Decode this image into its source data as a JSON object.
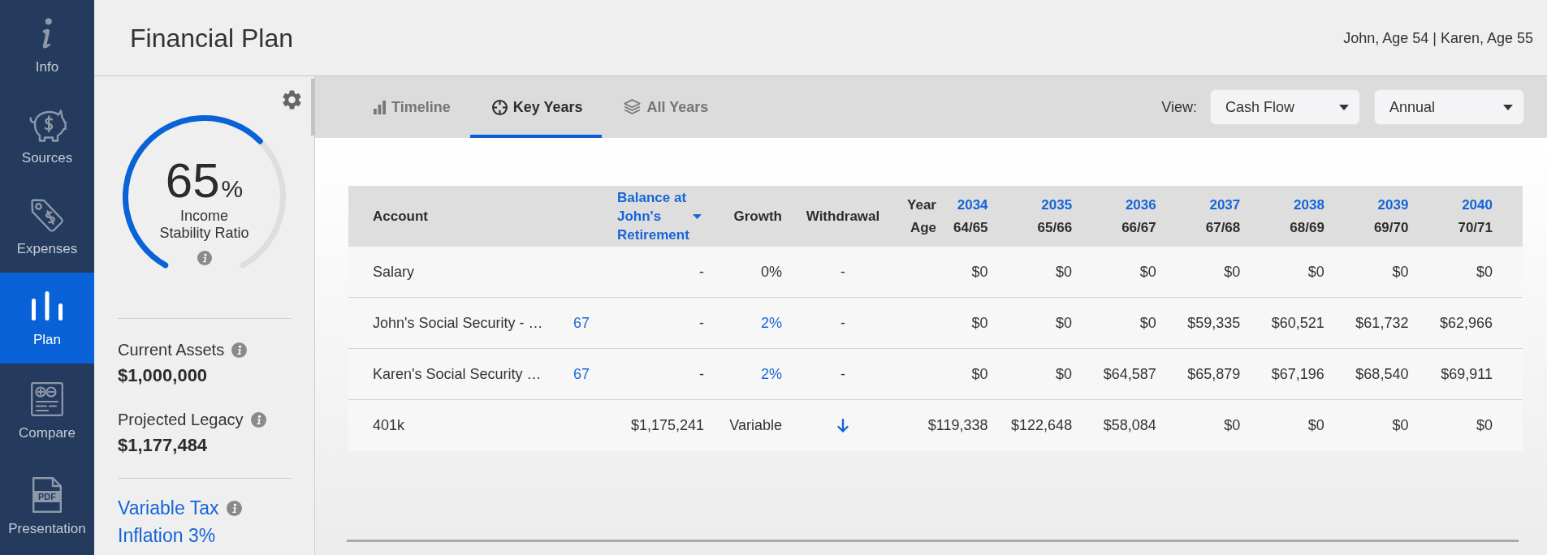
{
  "nav": {
    "items": [
      {
        "label": "Info",
        "selected": false
      },
      {
        "label": "Sources",
        "selected": false
      },
      {
        "label": "Expenses",
        "selected": false
      },
      {
        "label": "Plan",
        "selected": true
      },
      {
        "label": "Compare",
        "selected": false
      },
      {
        "label": "Presentation",
        "selected": false,
        "icon_text": "PDF"
      }
    ]
  },
  "header": {
    "title": "Financial Plan",
    "clients": "John, Age 54 | Karen, Age 55"
  },
  "summary": {
    "gauge": {
      "value": "65",
      "unit": "%",
      "label": "Income Stability Ratio"
    },
    "stats": [
      {
        "label": "Current Assets",
        "value": "$1,000,000"
      },
      {
        "label": "Projected Legacy",
        "value": "$1,177,484"
      }
    ],
    "settings": {
      "tax": "Variable Tax",
      "inflation": "Inflation 3%"
    }
  },
  "tabs": [
    {
      "label": "Timeline",
      "selected": false
    },
    {
      "label": "Key Years",
      "selected": true
    },
    {
      "label": "All Years",
      "selected": false
    }
  ],
  "view": {
    "label": "View:",
    "dropdowns": [
      {
        "value": "Cash Flow"
      },
      {
        "value": "Annual"
      }
    ]
  },
  "table": {
    "columns": [
      {
        "label": "Account",
        "sorted": false
      },
      {
        "label": "Balance at John's Retirement",
        "sorted": true
      },
      {
        "label": "Growth",
        "sorted": false
      },
      {
        "label": "Withdrawal",
        "sorted": false
      }
    ],
    "year_label": "Year",
    "age_label": "Age",
    "years": [
      {
        "year": "2034",
        "ages": "64/65"
      },
      {
        "year": "2035",
        "ages": "65/66"
      },
      {
        "year": "2036",
        "ages": "66/67"
      },
      {
        "year": "2037",
        "ages": "67/68"
      },
      {
        "year": "2038",
        "ages": "68/69"
      },
      {
        "year": "2039",
        "ages": "69/70"
      },
      {
        "year": "2040",
        "ages": "70/71"
      }
    ],
    "rows": [
      {
        "account": "Salary",
        "balance": "-",
        "growth": "0%",
        "growth_link": false,
        "withdrawal": "-",
        "withdrawal_arrow": false,
        "values": [
          "$0",
          "$0",
          "$0",
          "$0",
          "$0",
          "$0",
          "$0"
        ]
      },
      {
        "account": "John's Social Security - …",
        "claim_age": "67",
        "balance": "-",
        "growth": "2%",
        "growth_link": true,
        "withdrawal": "-",
        "withdrawal_arrow": false,
        "values": [
          "$0",
          "$0",
          "$0",
          "$59,335",
          "$60,521",
          "$61,732",
          "$62,966"
        ]
      },
      {
        "account": "Karen's Social Security …",
        "claim_age": "67",
        "balance": "-",
        "growth": "2%",
        "growth_link": true,
        "withdrawal": "-",
        "withdrawal_arrow": false,
        "values": [
          "$0",
          "$0",
          "$64,587",
          "$65,879",
          "$67,196",
          "$68,540",
          "$69,911"
        ]
      },
      {
        "account": "401k",
        "balance": "$1,175,241",
        "growth": "Variable",
        "growth_link": false,
        "withdrawal_arrow": true,
        "values": [
          "$119,338",
          "$122,648",
          "$58,084",
          "$0",
          "$0",
          "$0",
          "$0"
        ]
      }
    ]
  }
}
